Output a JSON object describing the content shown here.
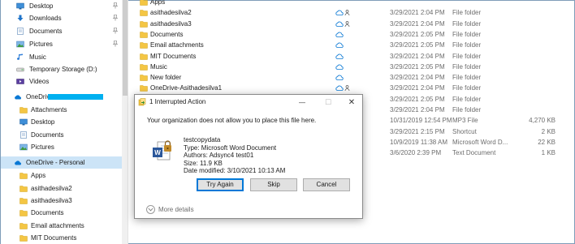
{
  "nav": {
    "items": [
      {
        "label": "Desktop",
        "icon": "desktop-icon",
        "pinned": true
      },
      {
        "label": "Downloads",
        "icon": "downloads-icon",
        "pinned": true
      },
      {
        "label": "Documents",
        "icon": "documents-icon",
        "pinned": true
      },
      {
        "label": "Pictures",
        "icon": "pictures-icon",
        "pinned": true
      },
      {
        "label": "Music",
        "icon": "music-icon",
        "pinned": false
      },
      {
        "label": "Temporary Storage (D:)",
        "icon": "drive-icon",
        "pinned": false
      },
      {
        "label": "Videos",
        "icon": "videos-icon",
        "pinned": false
      },
      {
        "label": "OneDrive -",
        "icon": "onedrive-cloud-icon",
        "pinned": false
      },
      {
        "label": "Attachments",
        "icon": "folder-icon",
        "pinned": false
      },
      {
        "label": "Desktop",
        "icon": "desktop-icon",
        "pinned": false
      },
      {
        "label": "Documents",
        "icon": "documents-icon",
        "pinned": false
      },
      {
        "label": "Pictures",
        "icon": "pictures-icon",
        "pinned": false
      },
      {
        "label": "OneDrive - Personal",
        "icon": "onedrive-cloud-icon",
        "pinned": false
      },
      {
        "label": "Apps",
        "icon": "folder-icon",
        "pinned": false
      },
      {
        "label": "asithadesilva2",
        "icon": "folder-icon",
        "pinned": false
      },
      {
        "label": "asithadesilva3",
        "icon": "folder-icon",
        "pinned": false
      },
      {
        "label": "Documents",
        "icon": "folder-icon",
        "pinned": false
      },
      {
        "label": "Email attachments",
        "icon": "folder-icon",
        "pinned": false
      },
      {
        "label": "MIT Documents",
        "icon": "folder-icon",
        "pinned": false
      }
    ]
  },
  "files": {
    "rows": [
      {
        "name": "Apps",
        "status": "",
        "date": "",
        "type": "",
        "size": "",
        "icon": "folder-icon"
      },
      {
        "name": "asithadesilva2",
        "status": "cloud-shared",
        "date": "3/29/2021 2:04 PM",
        "type": "File folder",
        "size": "",
        "icon": "folder-icon"
      },
      {
        "name": "asithadesilva3",
        "status": "cloud-shared",
        "date": "3/29/2021 2:04 PM",
        "type": "File folder",
        "size": "",
        "icon": "folder-icon"
      },
      {
        "name": "Documents",
        "status": "cloud",
        "date": "3/29/2021 2:05 PM",
        "type": "File folder",
        "size": "",
        "icon": "folder-icon"
      },
      {
        "name": "Email attachments",
        "status": "cloud",
        "date": "3/29/2021 2:05 PM",
        "type": "File folder",
        "size": "",
        "icon": "folder-icon"
      },
      {
        "name": "MIT Documents",
        "status": "cloud",
        "date": "3/29/2021 2:04 PM",
        "type": "File folder",
        "size": "",
        "icon": "folder-icon"
      },
      {
        "name": "Music",
        "status": "cloud",
        "date": "3/29/2021 2:05 PM",
        "type": "File folder",
        "size": "",
        "icon": "folder-icon"
      },
      {
        "name": "New folder",
        "status": "cloud",
        "date": "3/29/2021 2:04 PM",
        "type": "File folder",
        "size": "",
        "icon": "folder-icon"
      },
      {
        "name": "OneDrive-Asithadesilva1",
        "status": "cloud-shared",
        "date": "3/29/2021 2:04 PM",
        "type": "File folder",
        "size": "",
        "icon": "folder-icon"
      },
      {
        "name": "",
        "status": "",
        "date": "3/29/2021 2:05 PM",
        "type": "File folder",
        "size": "",
        "icon": ""
      },
      {
        "name": "",
        "status": "",
        "date": "3/29/2021 2:04 PM",
        "type": "File folder",
        "size": "",
        "icon": ""
      },
      {
        "name": "",
        "status": "",
        "date": "10/31/2019 12:54 PM",
        "type": "MP3 File",
        "size": "4,270 KB",
        "icon": ""
      },
      {
        "name": "",
        "status": "",
        "date": "3/29/2021 2:15 PM",
        "type": "Shortcut",
        "size": "2 KB",
        "icon": ""
      },
      {
        "name": "",
        "status": "",
        "date": "10/9/2019 11:38 AM",
        "type": "Microsoft Word D...",
        "size": "22 KB",
        "icon": ""
      },
      {
        "name": "",
        "status": "",
        "date": "3/6/2020 2:39 PM",
        "type": "Text Document",
        "size": "1 KB",
        "icon": ""
      }
    ]
  },
  "dialog": {
    "title": "1 Interrupted Action",
    "message": "Your organization does not allow you to place this file here.",
    "file_name": "testcopydata",
    "file_type": "Type: Microsoft Word Document",
    "file_authors": "Authors: Adsync4 test01",
    "file_size": "Size: 11.9 KB",
    "file_modified": "Date modified: 3/10/2021 10:13 AM",
    "buttons": {
      "try_again": "Try Again",
      "skip": "Skip",
      "cancel": "Cancel"
    },
    "more_details": "More details",
    "window_controls": {
      "minimize": "—",
      "maximize": "☐",
      "close": "✕"
    }
  },
  "colors": {
    "folder": "#f4c644",
    "cloud": "#0a78d4",
    "selected": "#cce4f7",
    "accent": "#0078d7",
    "redaction": "#00b0f0"
  }
}
